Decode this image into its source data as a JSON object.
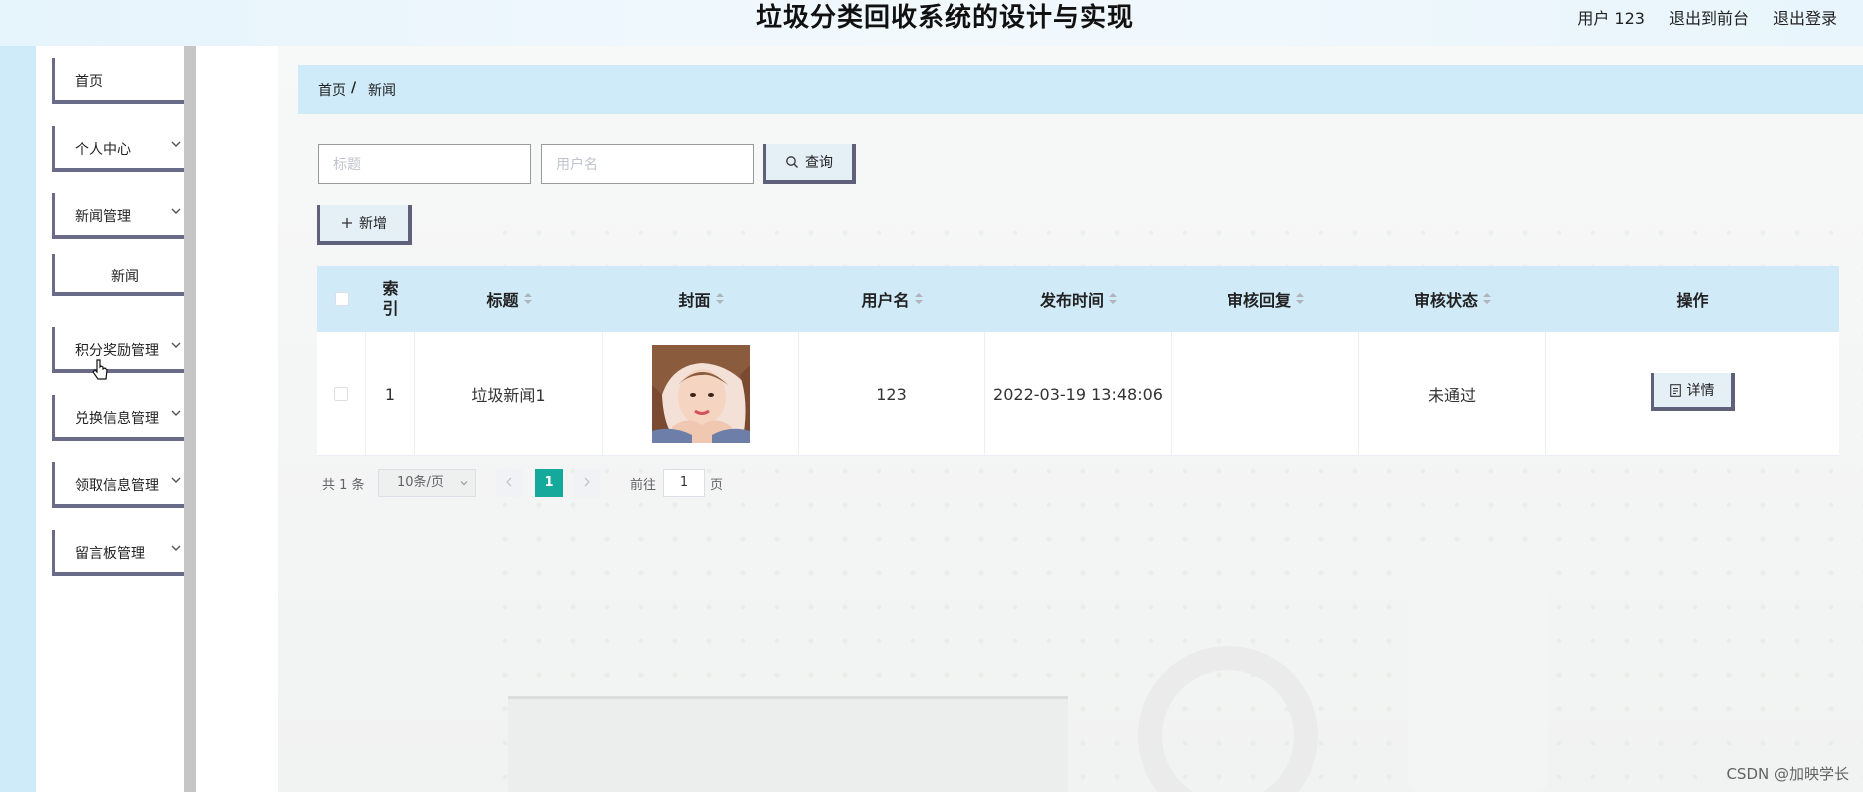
{
  "app": {
    "title": "垃圾分类回收系统的设计与实现",
    "user_label": "用户 123",
    "back_to_front": "退出到前台",
    "logout": "退出登录"
  },
  "sidebar": {
    "items": [
      {
        "label": "首页"
      },
      {
        "label": "个人中心"
      },
      {
        "label": "新闻管理"
      },
      {
        "label": "新闻"
      },
      {
        "label": "积分奖励管理"
      },
      {
        "label": "兑换信息管理"
      },
      {
        "label": "领取信息管理"
      },
      {
        "label": "留言板管理"
      }
    ]
  },
  "breadcrumb": {
    "home": "首页",
    "separator": "/",
    "current": "新闻"
  },
  "search": {
    "title_placeholder": "标题",
    "username_placeholder": "用户名",
    "query_label": "查询"
  },
  "toolbar": {
    "add_label": "新增"
  },
  "table": {
    "headers": {
      "index": "索\n引",
      "title": "标题",
      "cover": "封面",
      "username": "用户名",
      "publish_time": "发布时间",
      "review_reply": "审核回复",
      "review_status": "审核状态",
      "actions": "操作"
    },
    "rows": [
      {
        "index": "1",
        "title": "垃圾新闻1",
        "username": "123",
        "publish_time": "2022-03-19 13:48:06",
        "review_reply": "",
        "review_status": "未通过",
        "detail_label": "详情"
      }
    ]
  },
  "pagination": {
    "total": "共 1 条",
    "page_size": "10条/页",
    "current_page": "1",
    "goto_label": "前往",
    "goto_value": "1",
    "page_suffix": "页"
  },
  "watermark": "CSDN @加映学长",
  "colors": {
    "accent": "#14a99a",
    "header_bg": "#d0eaf8",
    "button_border": "#5f617a"
  }
}
